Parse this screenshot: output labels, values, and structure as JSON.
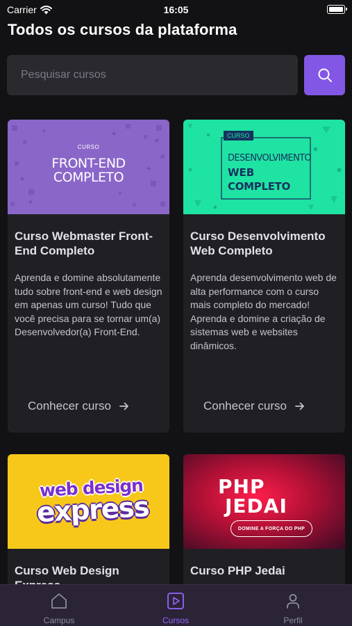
{
  "status_bar": {
    "carrier": "Carrier",
    "time": "16:05"
  },
  "header": {
    "title": "Todos os cursos da plataforma"
  },
  "search": {
    "placeholder": "Pesquisar cursos",
    "value": ""
  },
  "courses": [
    {
      "title": "Curso Webmaster Front-End Completo",
      "description": "Aprenda e domine absolutamente tudo sobre front-end e web design em apenas um curso! Tudo que você precisa para se tornar um(a) Desenvolvedor(a) Front-End.",
      "link": "Conhecer curso",
      "thumb": {
        "kicker": "CURSO",
        "line1": "FRONT-END",
        "line2": "COMPLETO"
      }
    },
    {
      "title": "Curso Desenvolvimento Web Completo",
      "description": "Aprenda desenvolvimento web de alta performance com o curso mais completo do mercado! Aprenda e domine a criação de sistemas web e websites dinâmicos.",
      "link": "Conhecer curso",
      "thumb": {
        "kicker": "CURSO",
        "line1": "DESENVOLVIMENTO",
        "line2": "WEB",
        "line3": "COMPLETO"
      }
    },
    {
      "title": "Curso Web Design Express",
      "thumb": {
        "line1": "web design",
        "line2": "express"
      }
    },
    {
      "title": "Curso PHP Jedai",
      "thumb": {
        "line1": "PHP",
        "line2": "JEDAI",
        "tagline": "DOMINE A FORÇA DO PHP"
      }
    }
  ],
  "tabs": [
    {
      "label": "Campus",
      "icon": "home-icon",
      "active": false
    },
    {
      "label": "Cursos",
      "icon": "play-square-icon",
      "active": true
    },
    {
      "label": "Perfil",
      "icon": "user-icon",
      "active": false
    }
  ],
  "colors": {
    "background": "#121214",
    "card": "#202024",
    "accent": "#8257e5",
    "tab_bar": "#2b2336"
  }
}
